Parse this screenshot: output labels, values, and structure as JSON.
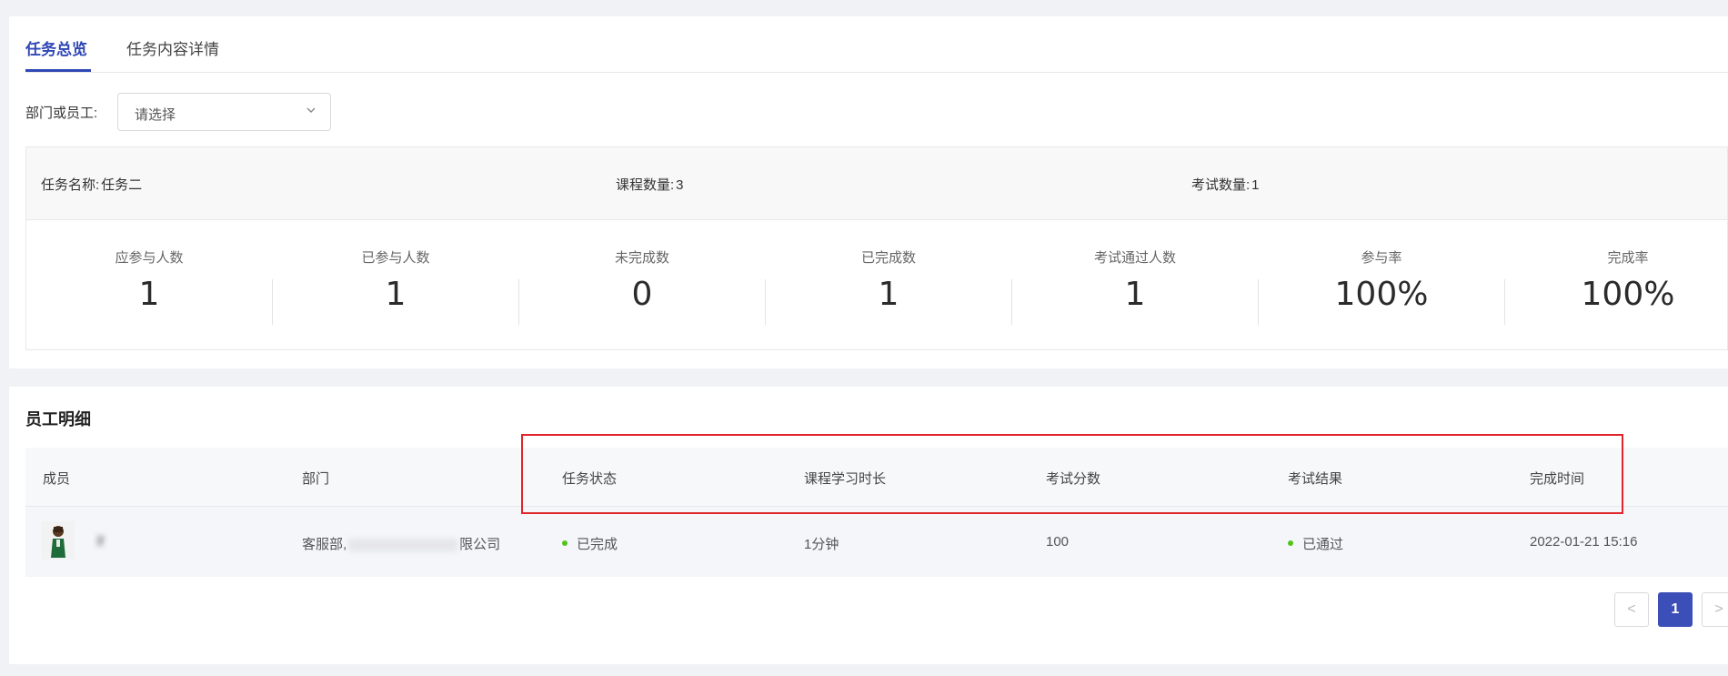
{
  "tabs": [
    {
      "label": "任务总览"
    },
    {
      "label": "任务内容详情"
    }
  ],
  "filter": {
    "label": "部门或员工:",
    "placeholder": "请选择"
  },
  "task_info": {
    "name_label": "任务名称:",
    "name_value": "任务二",
    "course_count_label": "课程数量:",
    "course_count_value": "3",
    "exam_count_label": "考试数量:",
    "exam_count_value": "1"
  },
  "stats": [
    {
      "label": "应参与人数",
      "value": "1"
    },
    {
      "label": "已参与人数",
      "value": "1"
    },
    {
      "label": "未完成数",
      "value": "0"
    },
    {
      "label": "已完成数",
      "value": "1"
    },
    {
      "label": "考试通过人数",
      "value": "1"
    },
    {
      "label": "参与率",
      "value": "100%"
    },
    {
      "label": "完成率",
      "value": "100%"
    }
  ],
  "employee_section": {
    "title": "员工明细",
    "columns": [
      "成员",
      "部门",
      "任务状态",
      "课程学习时长",
      "考试分数",
      "考试结果",
      "完成时间"
    ],
    "rows": [
      {
        "member": "İf",
        "department_prefix": "客服部,",
        "department_suffix": "限公司",
        "status": "已完成",
        "duration": "1分钟",
        "score": "100",
        "result": "已通过",
        "completed_at": "2022-01-21 15:16"
      }
    ]
  },
  "pagination": {
    "prev": "<",
    "current": "1",
    "next": ">"
  },
  "colors": {
    "accent": "#2f47b5",
    "success": "#52c41a",
    "highlight": "#e0262a"
  }
}
